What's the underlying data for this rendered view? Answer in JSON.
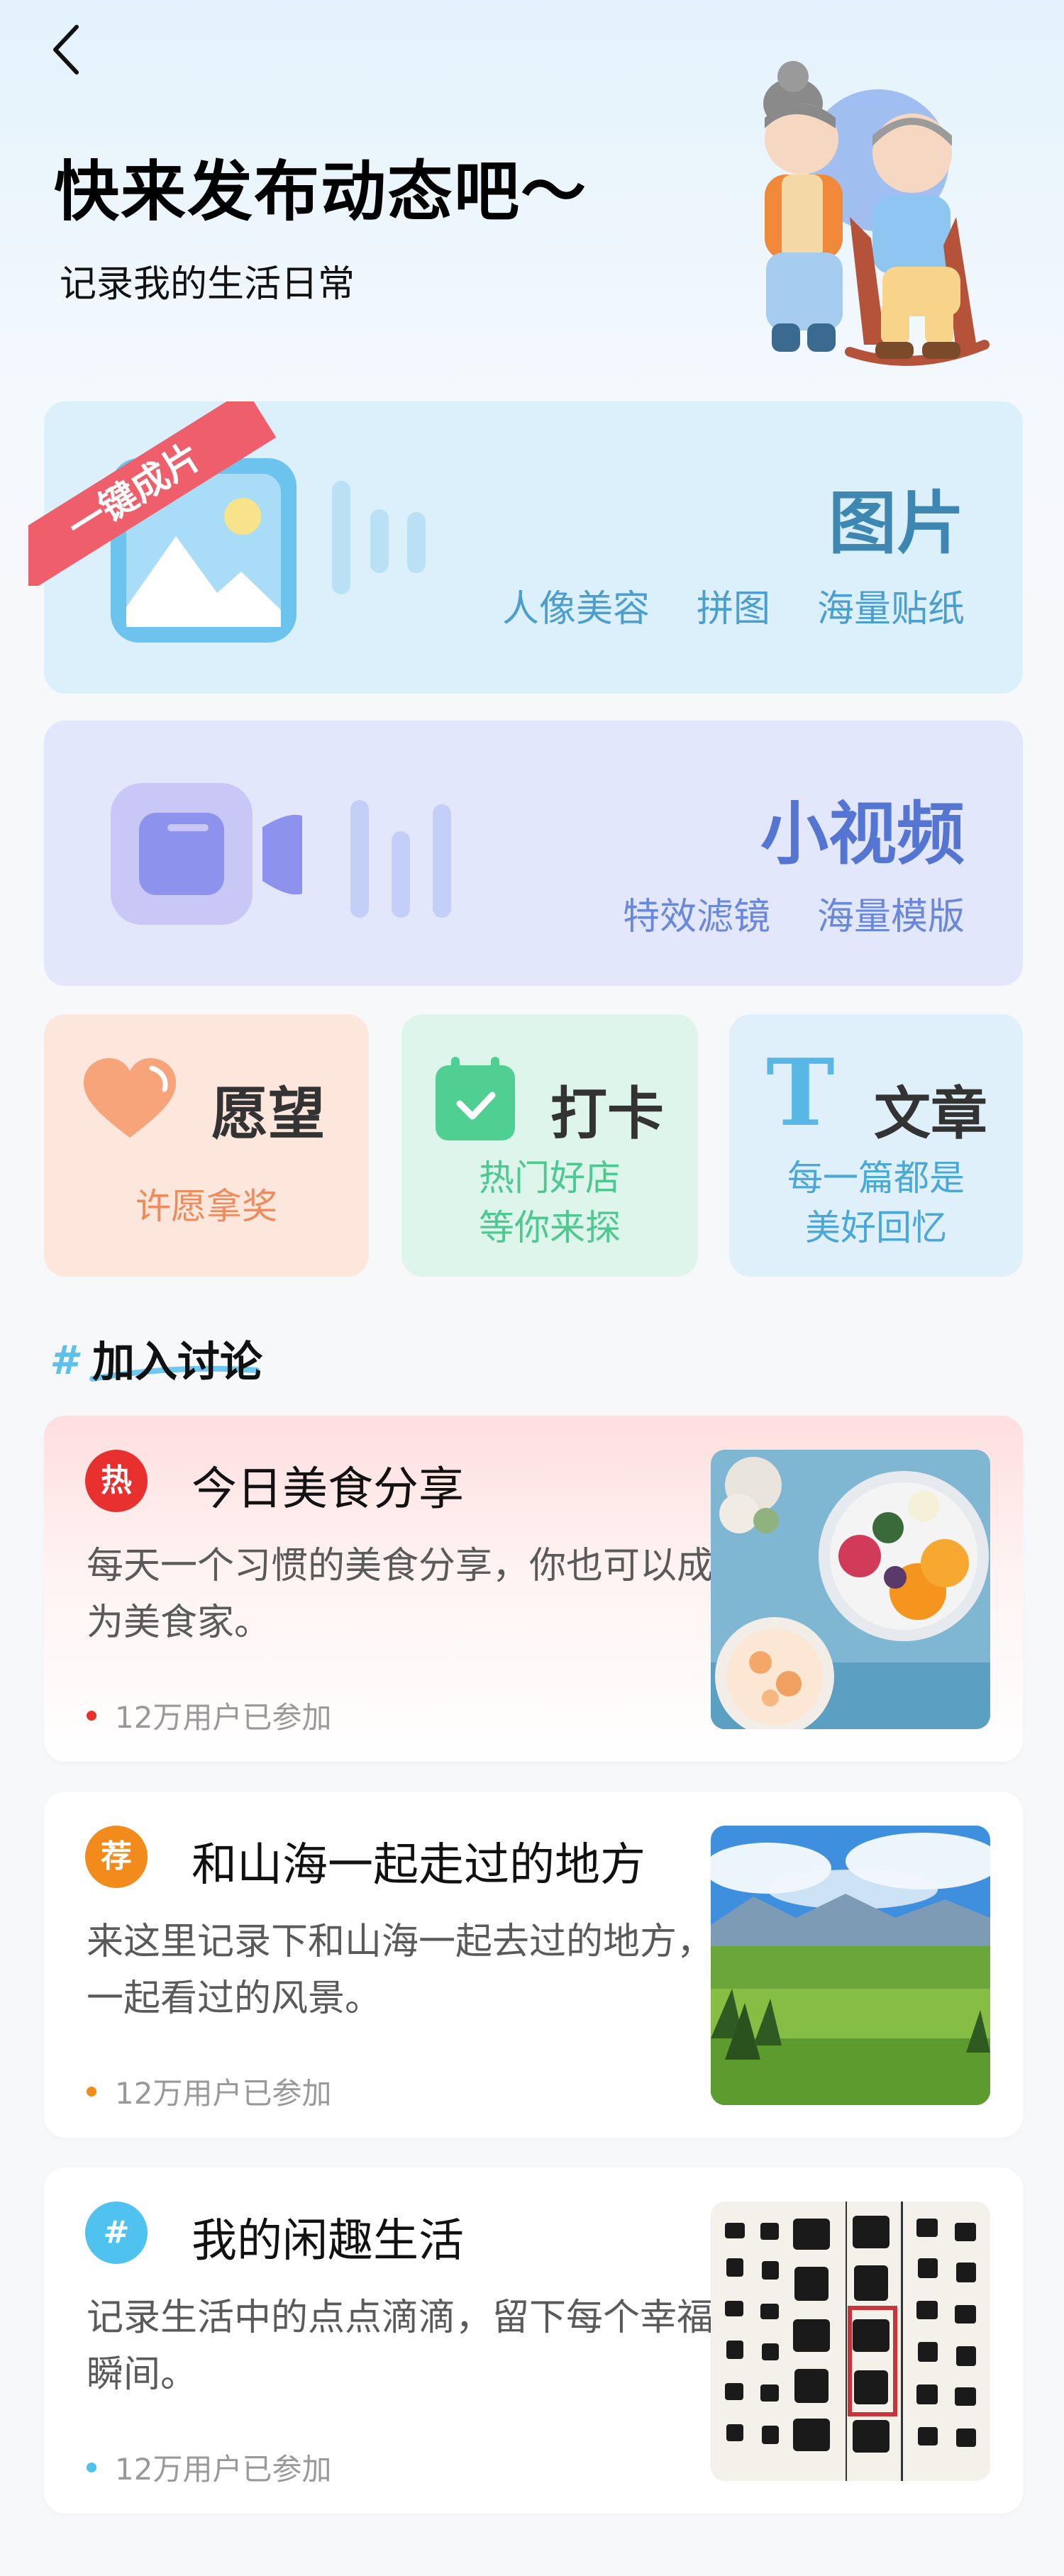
{
  "header": {
    "title": "快来发布动态吧～",
    "subtitle": "记录我的生活日常"
  },
  "photo_card": {
    "ribbon": "一键成片",
    "title": "图片",
    "tags": [
      "人像美容",
      "拼图",
      "海量贴纸"
    ]
  },
  "video_card": {
    "title": "小视频",
    "tags": [
      "特效滤镜",
      "海量模版"
    ]
  },
  "small_cards": {
    "wish": {
      "title": "愿望",
      "sub": [
        "许愿拿奖"
      ]
    },
    "checkin": {
      "title": "打卡",
      "sub": [
        "热门好店",
        "等你来探"
      ]
    },
    "article": {
      "title": "文章",
      "icon_letter": "T",
      "sub": [
        "每一篇都是",
        "美好回忆"
      ]
    }
  },
  "discussion": {
    "hash": "#",
    "title": "加入讨论"
  },
  "topics": [
    {
      "badge": "热",
      "badge_color": "#e8312f",
      "title": "今日美食分享",
      "desc": "每天一个习惯的美食分享，你也可以成为美食家。",
      "meta": "12万用户已参加",
      "image": "food-photo"
    },
    {
      "badge": "荐",
      "badge_color": "#f28a1c",
      "title": "和山海一起走过的地方",
      "desc": "来这里记录下和山海一起去过的地方，一起看过的风景。",
      "meta": "12万用户已参加",
      "image": "landscape-photo"
    },
    {
      "badge": "#",
      "badge_color": "#4fc2f0",
      "title": "我的闲趣生活",
      "desc": "记录生活中的点点滴滴，留下每个幸福瞬间。",
      "meta": "12万用户已参加",
      "image": "calligraphy-photo"
    }
  ],
  "colors": {
    "photo_accent": "#3f87b3",
    "video_accent": "#5575d2",
    "wish_accent": "#f08a5a",
    "checkin_accent": "#39c28b",
    "article_accent": "#4aa8d8"
  }
}
